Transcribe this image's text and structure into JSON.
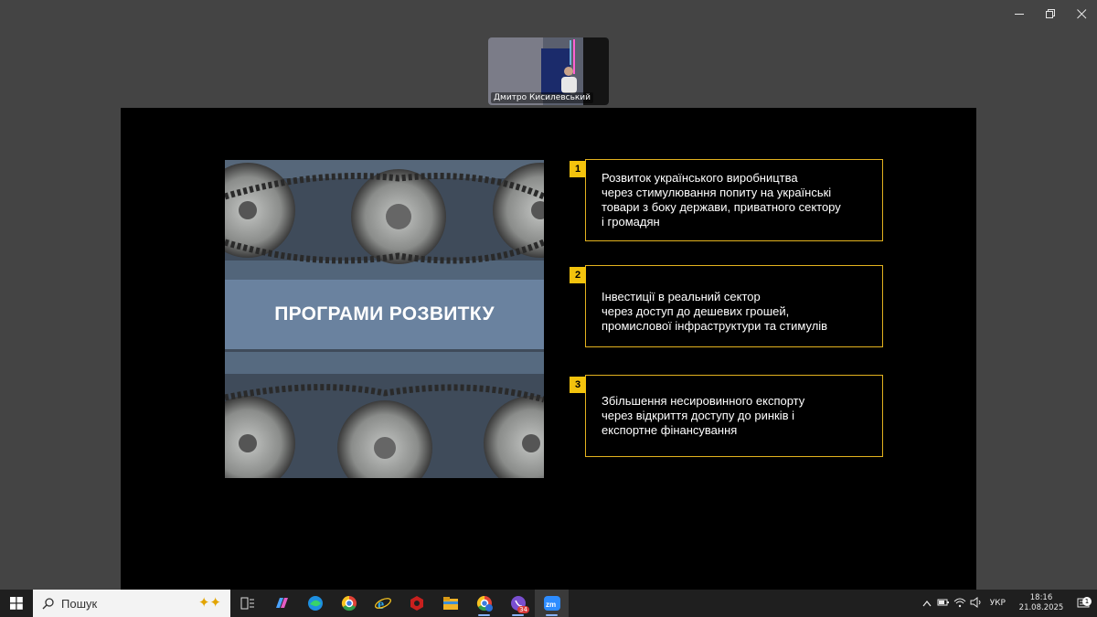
{
  "window": {
    "minimize_icon": "minimize-icon",
    "restore_icon": "restore-icon",
    "close_icon": "close-icon"
  },
  "participant": {
    "name": "Дмитро Кисилевський"
  },
  "slide": {
    "title": "ПРОГРАМИ РОЗВИТКУ",
    "accent_color": "#f3c30d",
    "items": [
      {
        "number": "1",
        "lines": [
          "Розвиток українського виробництва",
          "через стимулювання попиту на українські",
          "товари з боку держави, приватного сектору",
          "і громадян"
        ]
      },
      {
        "number": "2",
        "lines": [
          "Інвестиції в реальний сектор",
          "через доступ до дешевих грошей,",
          "промислової інфраструктури та стимулів"
        ]
      },
      {
        "number": "3",
        "lines": [
          "Збільшення несировинного експорту",
          "через відкриття доступу до ринків і",
          "експортне фінансування"
        ]
      }
    ]
  },
  "taskbar": {
    "search_label": "Пошук",
    "apps": [
      {
        "name": "task-view-icon",
        "badge": ""
      },
      {
        "name": "copilot-icon",
        "badge": ""
      },
      {
        "name": "edge-icon",
        "badge": ""
      },
      {
        "name": "chrome-icon",
        "badge": ""
      },
      {
        "name": "internet-explorer-icon",
        "badge": ""
      },
      {
        "name": "red-app-icon",
        "badge": ""
      },
      {
        "name": "file-explorer-icon",
        "badge": ""
      },
      {
        "name": "chrome-profile-icon",
        "badge": ""
      },
      {
        "name": "viber-icon",
        "badge": "34"
      },
      {
        "name": "zoom-icon",
        "badge": ""
      }
    ],
    "language": "УКР",
    "time": "18:16",
    "date": "21.08.2025",
    "notification_count": "1"
  }
}
